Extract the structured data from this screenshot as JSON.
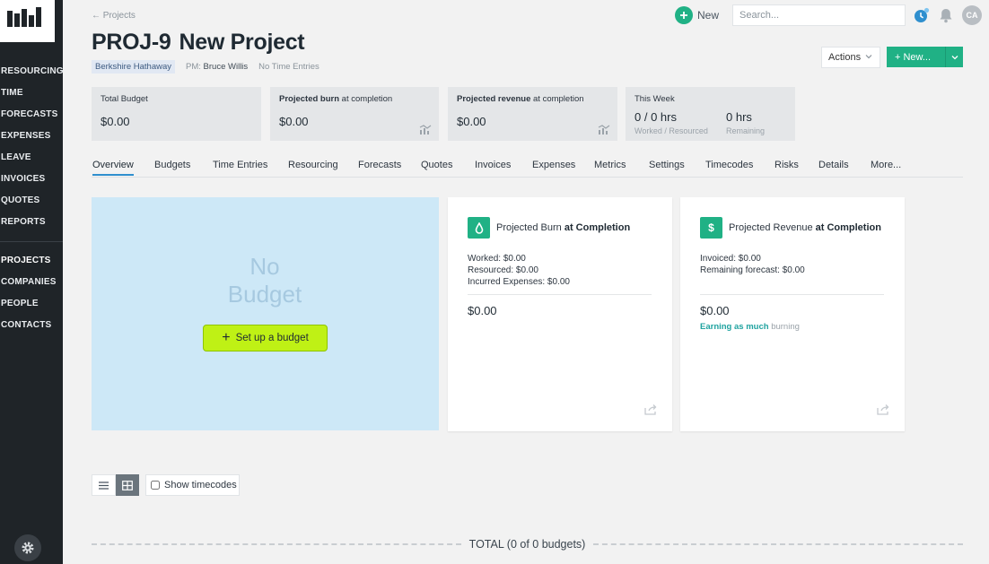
{
  "sidebar": {
    "nav_primary": [
      {
        "label": "RESOURCING"
      },
      {
        "label": "TIME"
      },
      {
        "label": "FORECASTS"
      },
      {
        "label": "EXPENSES"
      },
      {
        "label": "LEAVE"
      },
      {
        "label": "INVOICES"
      },
      {
        "label": "QUOTES"
      },
      {
        "label": "REPORTS"
      }
    ],
    "nav_secondary": [
      {
        "label": "PROJECTS",
        "active": true
      },
      {
        "label": "COMPANIES"
      },
      {
        "label": "PEOPLE"
      },
      {
        "label": "CONTACTS"
      }
    ]
  },
  "topbar": {
    "breadcrumb": "← Projects",
    "new_label": "New",
    "search_placeholder": "Search...",
    "avatar_initials": "CA"
  },
  "project": {
    "code": "PROJ-9",
    "name": "New Project",
    "client": "Berkshire Hathaway",
    "pm_label": "PM:",
    "pm_name": "Bruce Willis",
    "time_entries": "No Time Entries"
  },
  "header_actions": {
    "actions_label": "Actions",
    "new_label": "+ New..."
  },
  "stats": {
    "total_budget": {
      "label": "Total Budget",
      "value": "$0.00"
    },
    "projected_burn": {
      "label_bold": "Projected burn",
      "label_rest": " at completion",
      "value": "$0.00"
    },
    "projected_revenue": {
      "label_bold": "Projected revenue",
      "label_rest": " at completion",
      "value": "$0.00"
    },
    "this_week": {
      "label": "This Week",
      "worked_value": "0 / 0 hrs",
      "worked_sub": "Worked / Resourced",
      "remaining_value": "0 hrs",
      "remaining_sub": "Remaining"
    }
  },
  "tabs": [
    {
      "label": "Overview",
      "active": true
    },
    {
      "label": "Budgets"
    },
    {
      "label": "Time Entries"
    },
    {
      "label": "Resourcing"
    },
    {
      "label": "Forecasts"
    },
    {
      "label": "Quotes"
    },
    {
      "label": "Invoices"
    },
    {
      "label": "Expenses"
    },
    {
      "label": "Metrics"
    },
    {
      "label": "Settings"
    },
    {
      "label": "Timecodes"
    },
    {
      "label": "Risks"
    },
    {
      "label": "Details"
    },
    {
      "label": "More..."
    }
  ],
  "no_budget": {
    "line1": "No",
    "line2": "Budget",
    "button_label": "Set up a budget"
  },
  "burn_card": {
    "icon": "droplet-icon",
    "title": "Projected Burn ",
    "title_bold": "at Completion",
    "worked": "Worked: $0.00",
    "resourced": "Resourced: $0.00",
    "incurred": "Incurred Expenses: $0.00",
    "total": "$0.00"
  },
  "revenue_card": {
    "icon": "dollar-icon",
    "icon_glyph": "$",
    "title": "Projected Revenue ",
    "title_bold": "at Completion",
    "invoiced": "Invoiced: $0.00",
    "remaining": "Remaining forecast: $0.00",
    "total": "$0.00",
    "earning_bold": "Earning as much",
    "earning_rest": " burning"
  },
  "view_controls": {
    "show_timecodes_label": "Show timecodes"
  },
  "total_line": "TOTAL (0 of 0 budgets)",
  "colors": {
    "accent": "#20b185",
    "sidebar": "#1f2428",
    "setup_button": "#bff115",
    "tab_active": "#2f8fce"
  }
}
